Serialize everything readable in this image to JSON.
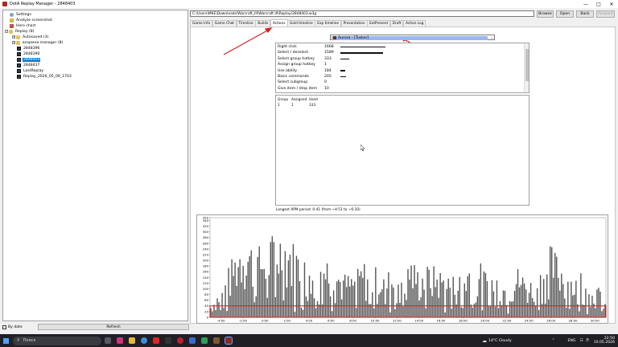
{
  "window": {
    "title": "DotA Replay Manager - 2848403",
    "minimize": "—",
    "maximize": "□",
    "close": "✕"
  },
  "tree": {
    "items": [
      {
        "label": "Settings",
        "icon": "settings-icon"
      },
      {
        "label": "Analyze screenshot",
        "icon": "screenshot-icon"
      },
      {
        "label": "Hero chart",
        "icon": "hero-chart-icon"
      },
      {
        "label": "Replay (8)",
        "icon": "folder-icon",
        "expander": "−"
      },
      {
        "label": "Autosaved (3)",
        "icon": "folder-icon",
        "expander": "+"
      },
      {
        "label": "всермне manager (8)",
        "icon": "folder-icon",
        "expander": "+"
      },
      {
        "label": "2848396",
        "icon": "replay-icon"
      },
      {
        "label": "2848390",
        "icon": "replay-icon"
      },
      {
        "label": "2848403",
        "icon": "replay-icon",
        "selected": true
      },
      {
        "label": "2848437",
        "icon": "replay-icon"
      },
      {
        "label": "LastReplay",
        "icon": "replay-icon"
      },
      {
        "label": "Replay_2026_05_09_1703",
        "icon": "replay-icon"
      }
    ]
  },
  "bottom": {
    "by_date_label": "By date",
    "refresh_label": "Refresh"
  },
  "path": {
    "value": "C:\\Users\\MKE\\Downloads\\Warcraft_III\\Warcraft III\\Replay\\2848403.w3g"
  },
  "buttons": {
    "browse": "Browse",
    "open": "Open",
    "back": "Back",
    "forward": "Forward"
  },
  "tabs": [
    "Game Info",
    "Game Chat",
    "Timeline",
    "Builds",
    "Actions",
    "Gold timeline",
    "Exp timeline",
    "Presentation",
    "ExtPresent",
    "Draft",
    "Action Log"
  ],
  "active_tab": "Actions",
  "player": {
    "name": "Aurora - [Tusker]"
  },
  "stats": {
    "rows": [
      {
        "name": "Right click",
        "value": "1668",
        "fraction": 1.0
      },
      {
        "name": "Select / deselect",
        "value": "1589",
        "fraction": 0.95
      },
      {
        "name": "Select group hotkey",
        "value": "333",
        "fraction": 0.2
      },
      {
        "name": "Assign group hotkey",
        "value": "1",
        "fraction": 0.0
      },
      {
        "name": "Use ability",
        "value": "184",
        "fraction": 0.11
      },
      {
        "name": "Basic commands",
        "value": "205",
        "fraction": 0.12
      },
      {
        "name": "Select subgroup",
        "value": "0",
        "fraction": 0.0
      },
      {
        "name": "Give item / drop item",
        "value": "10",
        "fraction": 0.0
      }
    ]
  },
  "groups": {
    "headers": [
      "Group",
      "Assigned",
      "Used"
    ],
    "rows": [
      [
        "1",
        "1",
        "333"
      ]
    ]
  },
  "longest_apm": "Longest APM period: 0:41 (from ~4:51 to ~6:10)",
  "chart_data": {
    "type": "bar",
    "xlabel": "",
    "ylabel": "",
    "ylim": [
      0,
      350
    ],
    "y_ticks": [
      0,
      20,
      40,
      60,
      80,
      100,
      120,
      140,
      160,
      180,
      200,
      220,
      240,
      260,
      280,
      300,
      320,
      340,
      350
    ],
    "x_ticks": [
      "-4:00",
      "-2:00",
      "0:00",
      "2:00",
      "4:00",
      "6:00",
      "8:00",
      "10:00",
      "12:00",
      "14:00",
      "16:00",
      "18:00",
      "20:00",
      "22:00",
      "24:00",
      "26:00",
      "28:00",
      "30:00"
    ],
    "x_range": [
      -5,
      31
    ],
    "reference_line": 40,
    "reference_color": "#e02020",
    "bar_color": "#555555",
    "envelope": [
      [
        -5,
        40
      ],
      [
        -4,
        110
      ],
      [
        -3,
        210
      ],
      [
        -2,
        300
      ],
      [
        -1,
        260
      ],
      [
        0,
        250
      ],
      [
        1,
        320
      ],
      [
        2,
        300
      ],
      [
        3,
        250
      ],
      [
        4,
        270
      ],
      [
        5,
        230
      ],
      [
        6,
        220
      ],
      [
        7,
        160
      ],
      [
        8,
        150
      ],
      [
        9,
        200
      ],
      [
        10,
        180
      ],
      [
        11,
        170
      ],
      [
        12,
        160
      ],
      [
        13,
        230
      ],
      [
        14,
        170
      ],
      [
        15,
        190
      ],
      [
        16,
        170
      ],
      [
        17,
        150
      ],
      [
        18,
        160
      ],
      [
        19,
        230
      ],
      [
        20,
        170
      ],
      [
        21,
        160
      ],
      [
        22,
        120
      ],
      [
        23,
        180
      ],
      [
        24,
        130
      ],
      [
        25,
        170
      ],
      [
        26,
        260
      ],
      [
        27,
        200
      ],
      [
        28,
        150
      ],
      [
        29,
        190
      ],
      [
        30,
        130
      ],
      [
        31,
        60
      ]
    ]
  },
  "taskbar": {
    "search_placeholder": "Поиск",
    "weather": "14°C  Cloudy",
    "lang": "ENG",
    "time": "22:50",
    "date": "10.05.2026"
  },
  "colors": {
    "accent": "#0078d7",
    "player_highlight": "#99b8f0",
    "annotation_arrow": "#d62020"
  }
}
